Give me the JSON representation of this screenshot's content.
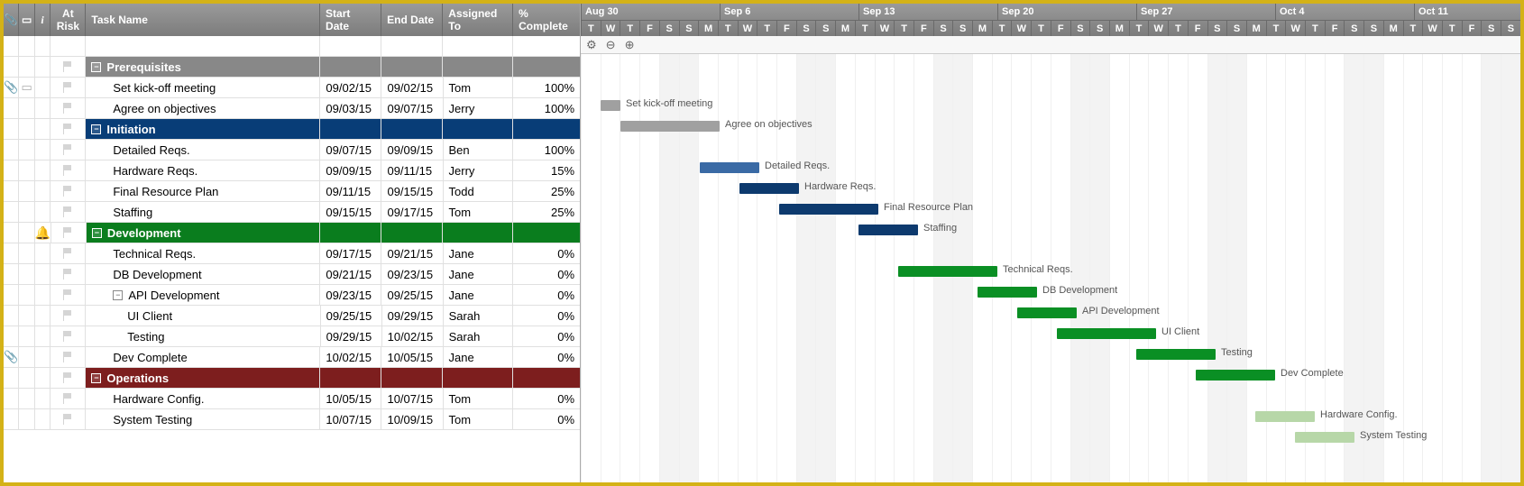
{
  "columns": {
    "atrisk": "At Risk",
    "task": "Task Name",
    "start": "Start Date",
    "end": "End Date",
    "assigned": "Assigned To",
    "pct": "% Complete"
  },
  "timeline": {
    "day_width": 22,
    "start_index": 0,
    "months": [
      {
        "label": "Aug 30",
        "day": 0
      },
      {
        "label": "Sep 6",
        "day": 7
      },
      {
        "label": "Sep 13",
        "day": 14
      },
      {
        "label": "Sep 20",
        "day": 21
      },
      {
        "label": "Sep 27",
        "day": 28
      },
      {
        "label": "Oct 4",
        "day": 35
      },
      {
        "label": "Oct 11",
        "day": 42
      }
    ],
    "days": [
      "T",
      "W",
      "T",
      "F",
      "S",
      "S",
      "M",
      "T",
      "W",
      "T",
      "F",
      "S",
      "S",
      "M",
      "T",
      "W",
      "T",
      "F",
      "S",
      "S",
      "M",
      "T",
      "W",
      "T",
      "F",
      "S",
      "S",
      "M",
      "T",
      "W",
      "T",
      "F",
      "S",
      "S",
      "M",
      "T",
      "W",
      "T",
      "F",
      "S",
      "S",
      "M",
      "T",
      "W",
      "T",
      "F",
      "S",
      "S"
    ],
    "weekend_indices": [
      4,
      5,
      11,
      12,
      18,
      19,
      25,
      26,
      32,
      33,
      39,
      40,
      46,
      47
    ]
  },
  "rows": [
    {
      "type": "blank"
    },
    {
      "type": "group",
      "color": "gray",
      "name": "Prerequisites"
    },
    {
      "type": "task",
      "indent": 1,
      "name": "Set kick-off meeting",
      "start": "09/02/15",
      "end": "09/02/15",
      "assigned": "Tom",
      "pct": "100%",
      "bar": {
        "from": 1,
        "to": 2,
        "color": "gray",
        "label": "Set kick-off meeting"
      },
      "att": true,
      "cmt": true
    },
    {
      "type": "task",
      "indent": 1,
      "name": "Agree on objectives",
      "start": "09/03/15",
      "end": "09/07/15",
      "assigned": "Jerry",
      "pct": "100%",
      "bar": {
        "from": 2,
        "to": 7,
        "color": "gray",
        "label": "Agree on objectives"
      }
    },
    {
      "type": "group",
      "color": "blue",
      "name": "Initiation"
    },
    {
      "type": "task",
      "indent": 1,
      "name": "Detailed Reqs.",
      "start": "09/07/15",
      "end": "09/09/15",
      "assigned": "Ben",
      "pct": "100%",
      "bar": {
        "from": 6,
        "to": 9,
        "color": "blue",
        "progress": 100,
        "label": "Detailed Reqs."
      }
    },
    {
      "type": "task",
      "indent": 1,
      "name": "Hardware Reqs.",
      "start": "09/09/15",
      "end": "09/11/15",
      "assigned": "Jerry",
      "pct": "15%",
      "bar": {
        "from": 8,
        "to": 11,
        "color": "navy",
        "label": "Hardware Reqs."
      }
    },
    {
      "type": "task",
      "indent": 1,
      "name": "Final Resource Plan",
      "start": "09/11/15",
      "end": "09/15/15",
      "assigned": "Todd",
      "pct": "25%",
      "bar": {
        "from": 10,
        "to": 15,
        "color": "navy",
        "label": "Final Resource Plan"
      }
    },
    {
      "type": "task",
      "indent": 1,
      "name": "Staffing",
      "start": "09/15/15",
      "end": "09/17/15",
      "assigned": "Tom",
      "pct": "25%",
      "bar": {
        "from": 14,
        "to": 17,
        "color": "navy",
        "label": "Staffing"
      }
    },
    {
      "type": "group",
      "color": "green",
      "name": "Development",
      "bell": true
    },
    {
      "type": "task",
      "indent": 1,
      "name": "Technical Reqs.",
      "start": "09/17/15",
      "end": "09/21/15",
      "assigned": "Jane",
      "pct": "0%",
      "bar": {
        "from": 16,
        "to": 21,
        "color": "green",
        "label": "Technical Reqs."
      }
    },
    {
      "type": "task",
      "indent": 1,
      "name": "DB Development",
      "start": "09/21/15",
      "end": "09/23/15",
      "assigned": "Jane",
      "pct": "0%",
      "bar": {
        "from": 20,
        "to": 23,
        "color": "green",
        "label": "DB Development"
      }
    },
    {
      "type": "task",
      "indent": 1,
      "name": "API Development",
      "toggle": true,
      "start": "09/23/15",
      "end": "09/25/15",
      "assigned": "Jane",
      "pct": "0%",
      "bar": {
        "from": 22,
        "to": 25,
        "color": "green",
        "label": "API Development"
      }
    },
    {
      "type": "task",
      "indent": 2,
      "name": "UI Client",
      "start": "09/25/15",
      "end": "09/29/15",
      "assigned": "Sarah",
      "pct": "0%",
      "bar": {
        "from": 24,
        "to": 29,
        "color": "green",
        "label": "UI Client"
      }
    },
    {
      "type": "task",
      "indent": 2,
      "name": "Testing",
      "start": "09/29/15",
      "end": "10/02/15",
      "assigned": "Sarah",
      "pct": "0%",
      "bar": {
        "from": 28,
        "to": 32,
        "color": "green",
        "label": "Testing"
      }
    },
    {
      "type": "task",
      "indent": 1,
      "name": "Dev Complete",
      "start": "10/02/15",
      "end": "10/05/15",
      "assigned": "Jane",
      "pct": "0%",
      "bar": {
        "from": 31,
        "to": 35,
        "color": "green",
        "label": "Dev Complete"
      },
      "att": true
    },
    {
      "type": "group",
      "color": "red",
      "name": "Operations"
    },
    {
      "type": "task",
      "indent": 1,
      "name": "Hardware Config.",
      "start": "10/05/15",
      "end": "10/07/15",
      "assigned": "Tom",
      "pct": "0%",
      "bar": {
        "from": 34,
        "to": 37,
        "color": "light",
        "label": "Hardware Config."
      }
    },
    {
      "type": "task",
      "indent": 1,
      "name": "System Testing",
      "start": "10/07/15",
      "end": "10/09/15",
      "assigned": "Tom",
      "pct": "0%",
      "bar": {
        "from": 36,
        "to": 39,
        "color": "light",
        "label": "System Testing"
      }
    }
  ],
  "toolbar": {
    "gear": "⚙",
    "zoom_out": "⊖",
    "zoom_in": "⊕"
  },
  "header_icons": {
    "attach": "📎",
    "comment": "▭",
    "info": "i"
  }
}
